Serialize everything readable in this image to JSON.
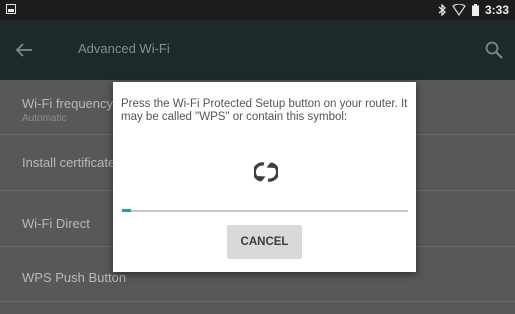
{
  "status_bar": {
    "icons": [
      "image-icon",
      "bluetooth-icon",
      "wifi-icon",
      "battery-icon"
    ],
    "time": "3:33"
  },
  "action_bar": {
    "title": "Advanced Wi-Fi",
    "icons": [
      "back-arrow-icon",
      "search-icon"
    ]
  },
  "settings_list": {
    "items": [
      {
        "title": "Wi-Fi frequency band",
        "subtitle": "Automatic"
      },
      {
        "title": "Install certificates"
      },
      {
        "title": "Wi-Fi Direct"
      },
      {
        "title": "WPS Push Button"
      }
    ]
  },
  "wps_dialog": {
    "message": "Press the Wi-Fi Protected Setup button on your router. It may be called \"WPS\" or contain this symbol:",
    "icon": "wps-icon",
    "progress": 0.03,
    "cancel_label": "CANCEL"
  },
  "colors": {
    "status_bar": "#1c1c1c",
    "action_bar": "#1c2a2b",
    "accent": "#13a5a1",
    "dialog_bg": "#ffffff"
  }
}
